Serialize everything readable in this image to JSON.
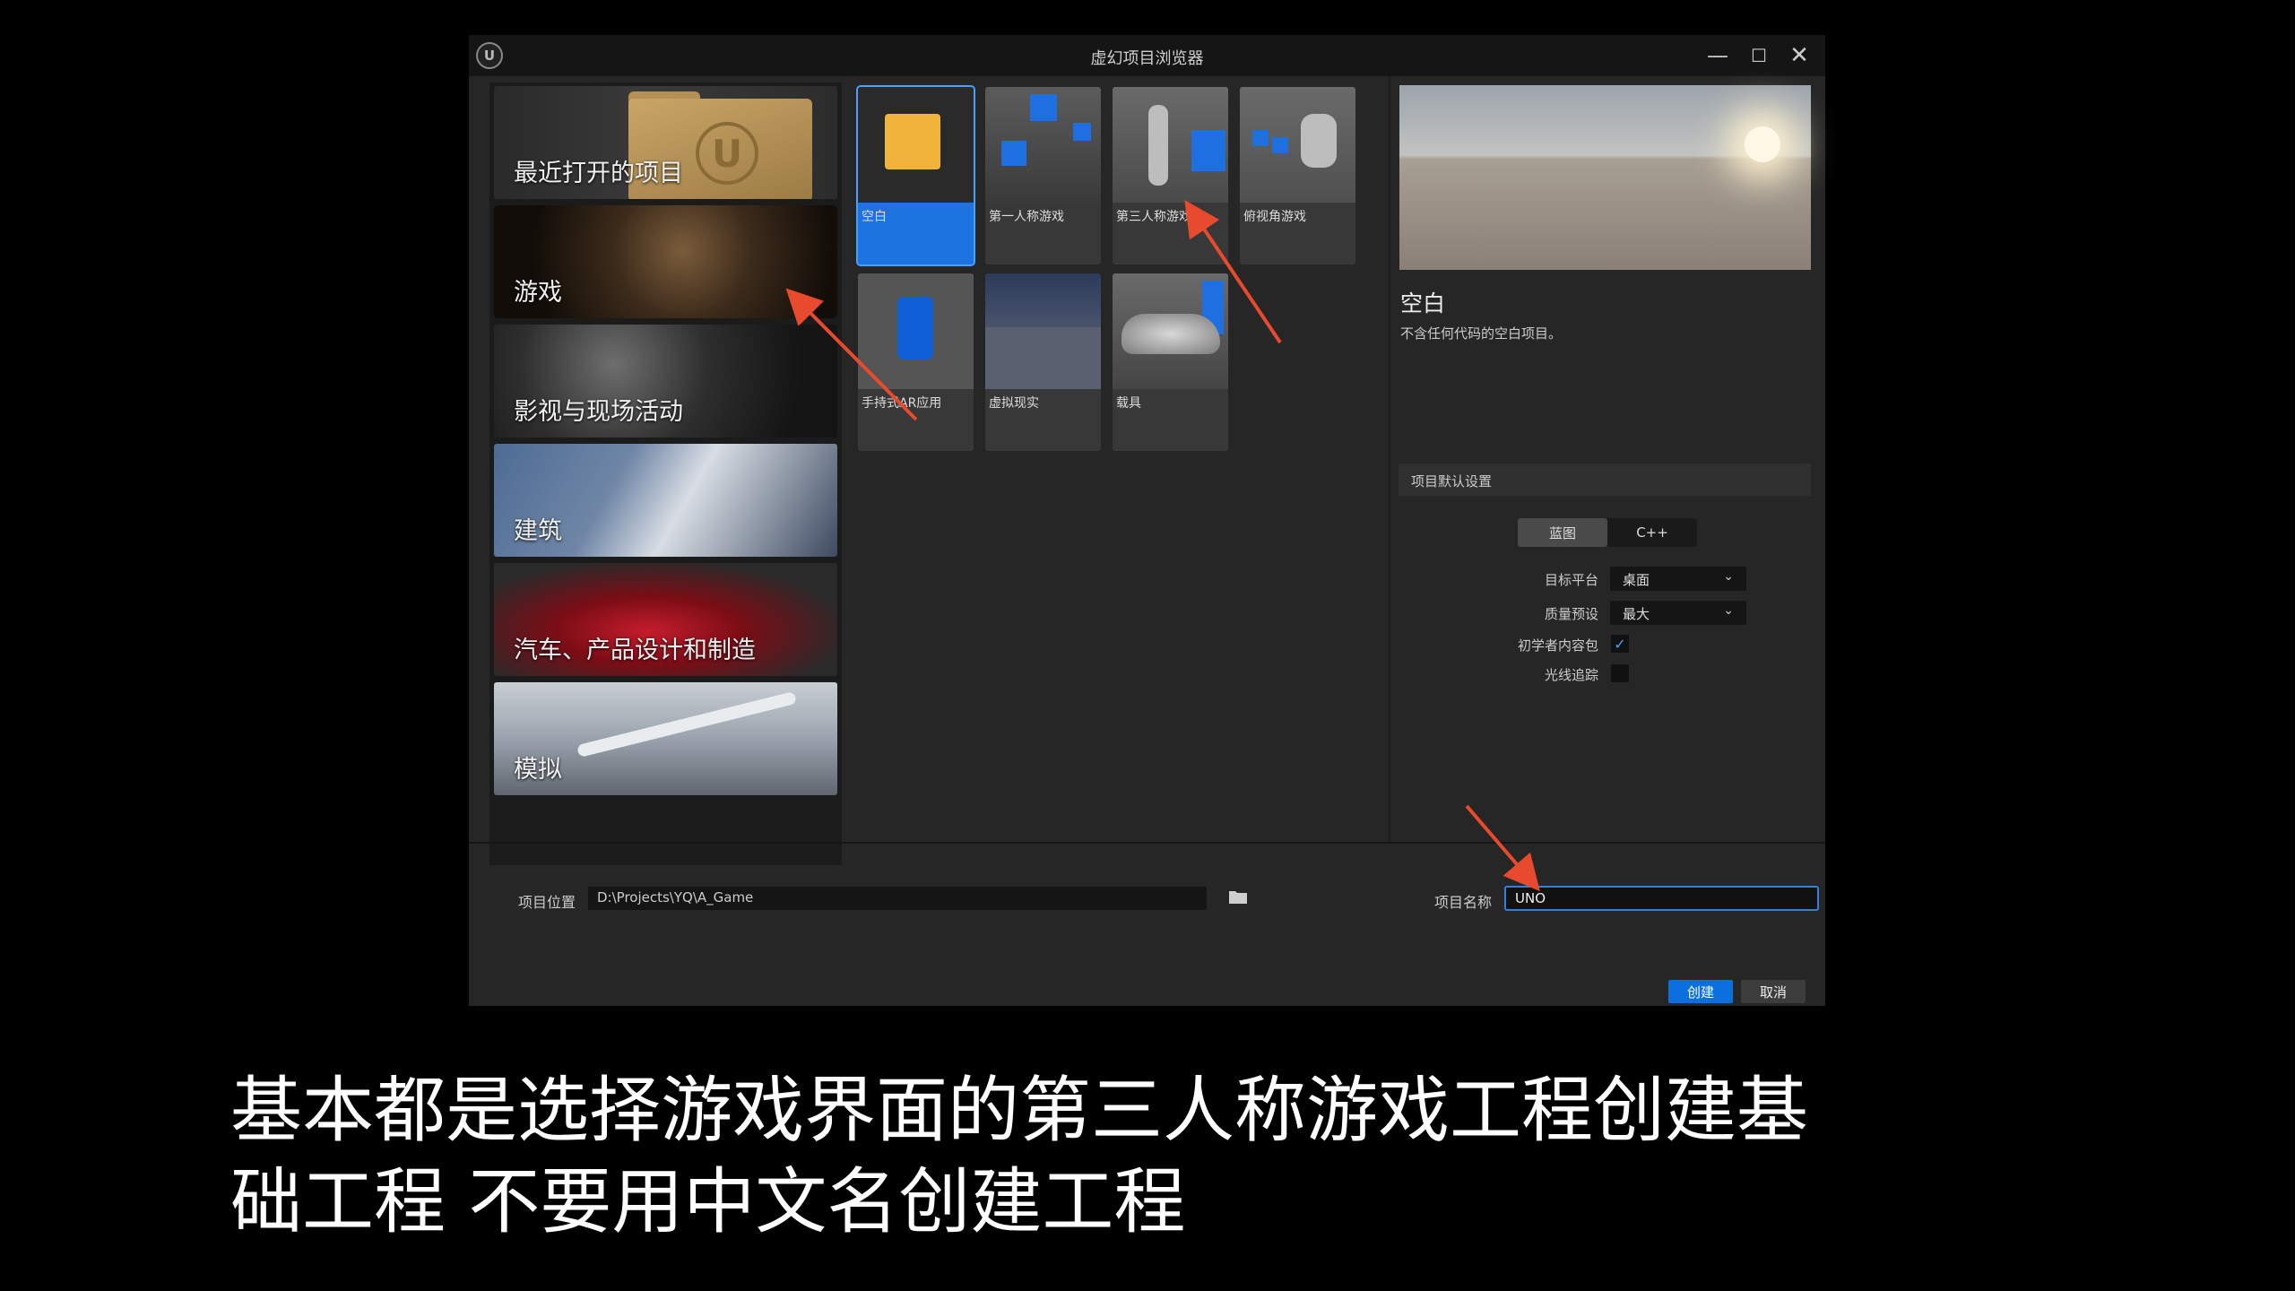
{
  "window": {
    "title": "虚幻项目浏览器",
    "logo_text": "U",
    "minimize": "—",
    "maximize": "☐",
    "close": "✕"
  },
  "categories": [
    {
      "label": "最近打开的项目"
    },
    {
      "label": "游戏",
      "selected": true
    },
    {
      "label": "影视与现场活动"
    },
    {
      "label": "建筑"
    },
    {
      "label": "汽车、产品设计和制造"
    },
    {
      "label": "模拟"
    }
  ],
  "templates": [
    {
      "label": "空白",
      "selected": true
    },
    {
      "label": "第一人称游戏"
    },
    {
      "label": "第三人称游戏"
    },
    {
      "label": "俯视角游戏"
    },
    {
      "label": "手持式AR应用"
    },
    {
      "label": "虚拟现实"
    },
    {
      "label": "载具"
    }
  ],
  "details": {
    "title": "空白",
    "description": "不含任何代码的空白项目。"
  },
  "settings": {
    "header": "项目默认设置",
    "blueprint": "蓝图",
    "cpp": "C++",
    "target_platform_label": "目标平台",
    "target_platform_value": "桌面",
    "quality_label": "质量预设",
    "quality_value": "最大",
    "starter_content_label": "初学者内容包",
    "starter_content_checked": true,
    "raytracing_label": "光线追踪",
    "raytracing_checked": false,
    "check_glyph": "✓"
  },
  "footer": {
    "location_label": "项目位置",
    "location_value": "D:\\Projects\\YQ\\A_Game",
    "name_label": "项目名称",
    "name_value": "UNO",
    "create": "创建",
    "cancel": "取消"
  },
  "colors": {
    "accent": "#1d74e0",
    "arrow": "#e84a2e"
  },
  "subtitle": {
    "line1": "基本都是选择游戏界面的第三人称游戏工程创建基",
    "line2": "础工程 不要用中文名创建工程"
  }
}
